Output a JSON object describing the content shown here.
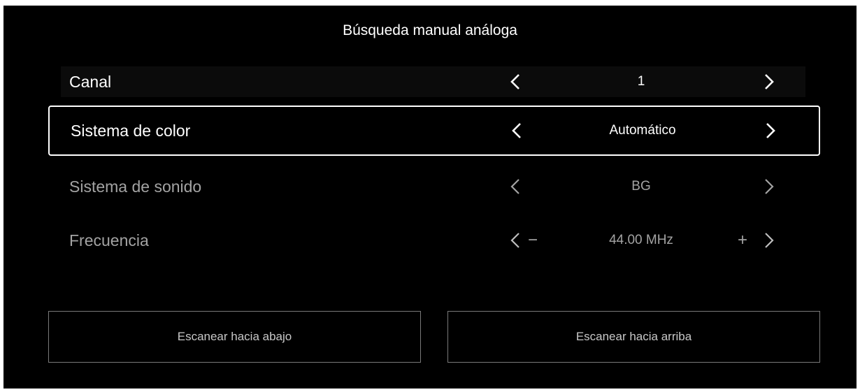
{
  "header": {
    "title": "Búsqueda manual análoga"
  },
  "settings": {
    "canal": {
      "label": "Canal",
      "value": "1"
    },
    "sistema_color": {
      "label": "Sistema de color",
      "value": "Automático"
    },
    "sistema_sonido": {
      "label": "Sistema de sonido",
      "value": "BG"
    },
    "frecuencia": {
      "label": "Frecuencia",
      "value": "44.00 MHz",
      "minus": "−",
      "plus": "+"
    }
  },
  "buttons": {
    "scan_down": "Escanear hacia abajo",
    "scan_up": "Escanear hacia arriba"
  },
  "icons": {
    "prev": "chevron-left-icon",
    "next": "chevron-right-icon"
  },
  "colors": {
    "background": "#000000",
    "focus_border": "#ffffff",
    "disabled_text": "#a3a3a3"
  }
}
